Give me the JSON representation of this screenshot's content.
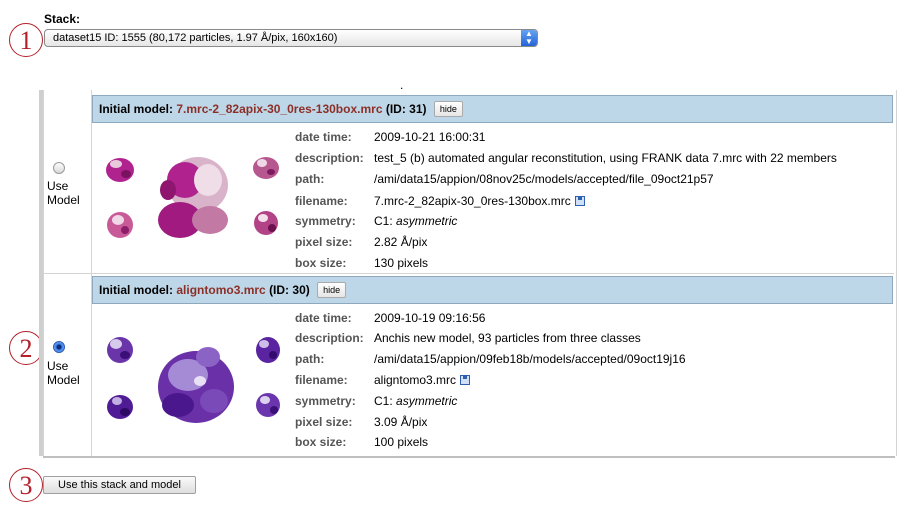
{
  "stack": {
    "label": "Stack:",
    "selected": "dataset15 ID: 1555 (80,172 particles, 1.97 Å/pix, 160x160)"
  },
  "callouts": [
    "1",
    "2",
    "3"
  ],
  "radio_label_line1": "Use",
  "radio_label_line2": "Model",
  "models": [
    {
      "header_prefix": "Initial model:",
      "filename": "7.mrc-2_82apix-30_0res-130box.mrc",
      "id_text": "(ID: 31)",
      "hide_label": "hide",
      "selected": false,
      "fields": [
        {
          "key": "date time:",
          "value": "2009-10-21 16:00:31"
        },
        {
          "key": "description:",
          "value": "test_5 (b) automated angular reconstitution, using FRANK data 7.mrc with 22 members"
        },
        {
          "key": "path:",
          "value": "/ami/data15/appion/08nov25c/models/accepted/file_09oct21p57"
        },
        {
          "key": "filename:",
          "value": "7.mrc-2_82apix-30_0res-130box.mrc"
        },
        {
          "key": "symmetry:",
          "value": "C1:",
          "value_italic": "asymmetric"
        },
        {
          "key": "pixel size:",
          "value": "2.82 Å/pix"
        },
        {
          "key": "box size:",
          "value": "130 pixels"
        }
      ],
      "color_main": "#b0238f",
      "color_light": "#e8c9dc"
    },
    {
      "header_prefix": "Initial model:",
      "filename": "aligntomo3.mrc",
      "id_text": "(ID: 30)",
      "hide_label": "hide",
      "selected": true,
      "fields": [
        {
          "key": "date time:",
          "value": "2009-10-19 09:16:56"
        },
        {
          "key": "description:",
          "value": "Anchis new model, 93 particles from three classes"
        },
        {
          "key": "path:",
          "value": "/ami/data15/appion/09feb18b/models/accepted/09oct19j16"
        },
        {
          "key": "filename:",
          "value": "aligntomo3.mrc"
        },
        {
          "key": "symmetry:",
          "value": "C1:",
          "value_italic": "asymmetric"
        },
        {
          "key": "pixel size:",
          "value": "3.09 Å/pix"
        },
        {
          "key": "box size:",
          "value": "100 pixels"
        }
      ],
      "color_main": "#5a1f9e",
      "color_light": "#c9b6e6"
    }
  ],
  "dot_text": ".",
  "submit_label": "Use this stack and model"
}
